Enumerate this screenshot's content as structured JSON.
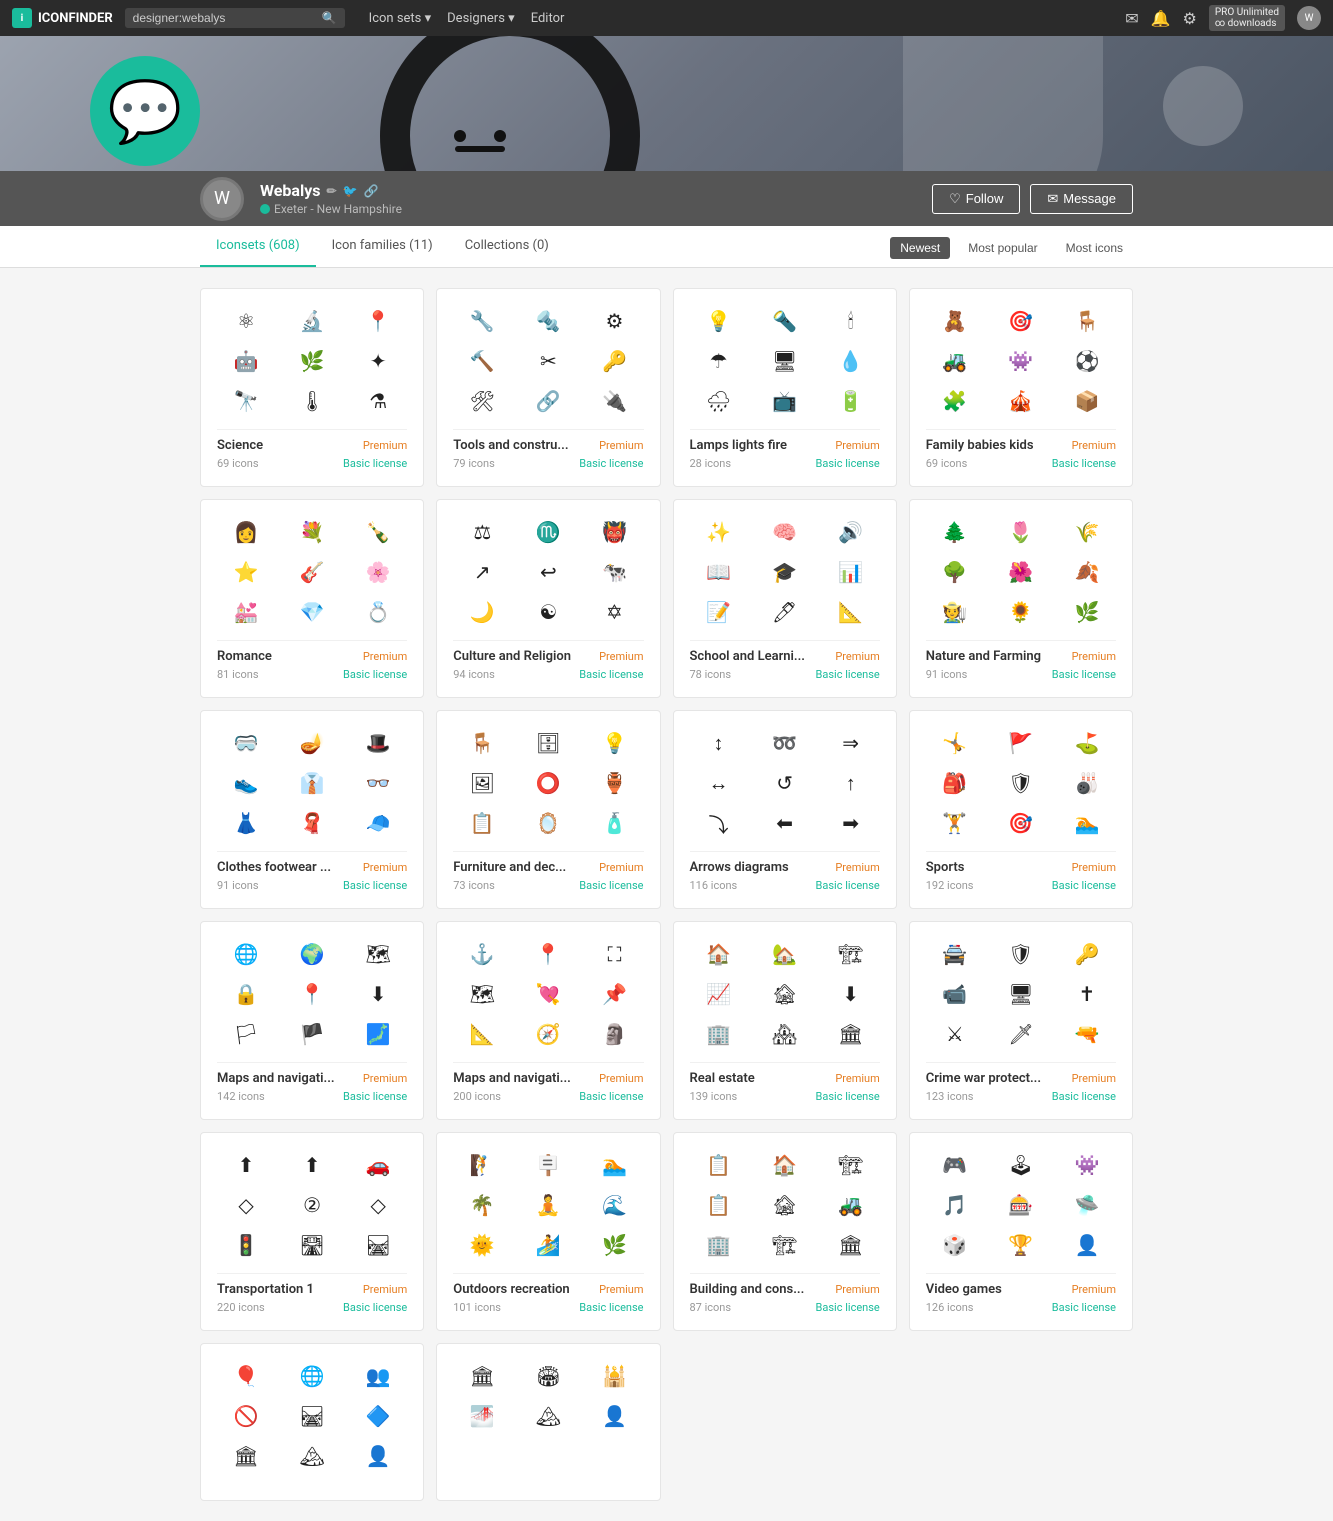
{
  "navbar": {
    "brand": "ICONFINDER",
    "search_placeholder": "designer:webalys",
    "search_value": "designer:webalys",
    "nav_links": [
      {
        "label": "Icon sets",
        "has_dropdown": true
      },
      {
        "label": "Designers",
        "has_dropdown": true
      },
      {
        "label": "Editor",
        "has_dropdown": false
      }
    ],
    "pro_label": "PRO Unlimited",
    "pro_sub": "∞ downloads"
  },
  "hero": {},
  "profile": {
    "name": "Webalys",
    "location": "Exeter - New Hampshire",
    "follow_btn": "Follow",
    "message_btn": "Message"
  },
  "tabs": {
    "items": [
      {
        "label": "Iconsets (608)",
        "active": true
      },
      {
        "label": "Icon families (11)",
        "active": false
      },
      {
        "label": "Collections (0)",
        "active": false
      }
    ],
    "filters": [
      {
        "label": "Newest",
        "active": true
      },
      {
        "label": "Most popular",
        "active": false
      },
      {
        "label": "Most icons",
        "active": false
      }
    ]
  },
  "cards": [
    {
      "title": "Science",
      "count": "69 icons",
      "premium": "Premium",
      "license": "Basic license",
      "icons": [
        "⚛",
        "🔬",
        "📍",
        "🤖",
        "🌿",
        "✦",
        "🔭",
        "🌡",
        "⚗"
      ]
    },
    {
      "title": "Tools and constru...",
      "count": "79 icons",
      "premium": "Premium",
      "license": "Basic license",
      "icons": [
        "🔧",
        "🔩",
        "⚙",
        "🔨",
        "✂",
        "🔑",
        "🛠",
        "🔗",
        "🔌"
      ]
    },
    {
      "title": "Lamps lights fire",
      "count": "28 icons",
      "premium": "Premium",
      "license": "Basic license",
      "icons": [
        "💡",
        "🔦",
        "🕯",
        "☂",
        "🖥",
        "💧",
        "🌧",
        "📺",
        "🔋"
      ]
    },
    {
      "title": "Family babies kids",
      "count": "69 icons",
      "premium": "Premium",
      "license": "Basic license",
      "icons": [
        "🧸",
        "🎯",
        "🪑",
        "🚜",
        "👾",
        "⚽",
        "🧩",
        "🎪",
        "📦"
      ]
    },
    {
      "title": "Romance",
      "count": "81 icons",
      "premium": "Premium",
      "license": "Basic license",
      "icons": [
        "👩",
        "💐",
        "🍾",
        "⭐",
        "🎸",
        "🌸",
        "💒",
        "💎",
        "💍"
      ]
    },
    {
      "title": "Culture and Religion",
      "count": "94 icons",
      "premium": "Premium",
      "license": "Basic license",
      "icons": [
        "⚖",
        "♏",
        "👹",
        "↗",
        "↩",
        "🐄",
        "🌙",
        "☯",
        "✡"
      ]
    },
    {
      "title": "School and Learni...",
      "count": "78 icons",
      "premium": "Premium",
      "license": "Basic license",
      "icons": [
        "✨",
        "🧠",
        "🔊",
        "📖",
        "🎓",
        "📊",
        "📝",
        "🖊",
        "📐"
      ]
    },
    {
      "title": "Nature and Farming",
      "count": "91 icons",
      "premium": "Premium",
      "license": "Basic license",
      "icons": [
        "🌲",
        "🌷",
        "🌾",
        "🌳",
        "🌺",
        "🍂",
        "🧑‍🌾",
        "🌻",
        "🌿"
      ]
    },
    {
      "title": "Clothes footwear ...",
      "count": "91 icons",
      "premium": "Premium",
      "license": "Basic license",
      "icons": [
        "🥽",
        "🪔",
        "🎩",
        "👟",
        "👔",
        "👓",
        "👗",
        "🧣",
        "🧢"
      ]
    },
    {
      "title": "Furniture and dec...",
      "count": "73 icons",
      "premium": "Premium",
      "license": "Basic license",
      "icons": [
        "🪑",
        "🗄",
        "💡",
        "🖼",
        "⭕",
        "🏺",
        "📋",
        "🪞",
        "🧴"
      ]
    },
    {
      "title": "Arrows diagrams",
      "count": "116 icons",
      "premium": "Premium",
      "license": "Basic license",
      "icons": [
        "↕",
        "➿",
        "⇒",
        "↔",
        "↺",
        "↑",
        "⤵",
        "⬅",
        "➡"
      ]
    },
    {
      "title": "Sports",
      "count": "192 icons",
      "premium": "Premium",
      "license": "Basic license",
      "icons": [
        "🤸",
        "🚩",
        "⛳",
        "🎒",
        "🛡",
        "🎳",
        "🏋",
        "🎯",
        "🏊"
      ]
    },
    {
      "title": "Maps and navigati...",
      "count": "142 icons",
      "premium": "Premium",
      "license": "Basic license",
      "icons": [
        "🌐",
        "🌍",
        "🗺",
        "🔒",
        "📍",
        "⬇",
        "🏳",
        "🏴",
        "🗾"
      ]
    },
    {
      "title": "Maps and navigati...",
      "count": "200 icons",
      "premium": "Premium",
      "license": "Basic license",
      "icons": [
        "⚓",
        "📍",
        "⛶",
        "🗺",
        "💘",
        "📌",
        "📐",
        "🧭",
        "🗿"
      ]
    },
    {
      "title": "Real estate",
      "count": "139 icons",
      "premium": "Premium",
      "license": "Basic license",
      "icons": [
        "🏠",
        "🏡",
        "🏗",
        "📈",
        "🏚",
        "⬇",
        "🏢",
        "🏘",
        "🏛"
      ]
    },
    {
      "title": "Crime war protect...",
      "count": "123 icons",
      "premium": "Premium",
      "license": "Basic license",
      "icons": [
        "🚔",
        "🛡",
        "🔑",
        "📹",
        "🖥",
        "✝",
        "⚔",
        "🗡",
        "🔫"
      ]
    },
    {
      "title": "Transportation 1",
      "count": "220 icons",
      "premium": "Premium",
      "license": "Basic license",
      "icons": [
        "⬆",
        "⬆",
        "🚗",
        "◇",
        "②",
        "◇",
        "🚦",
        "🛣",
        "🛤"
      ]
    },
    {
      "title": "Outdoors recreation",
      "count": "101 icons",
      "premium": "Premium",
      "license": "Basic license",
      "icons": [
        "🧗",
        "🪧",
        "🏊",
        "🌴",
        "🧘",
        "🌊",
        "🌞",
        "🏄",
        "🌿"
      ]
    },
    {
      "title": "Building and cons...",
      "count": "87 icons",
      "premium": "Premium",
      "license": "Basic license",
      "icons": [
        "📋",
        "🏠",
        "🏗",
        "📋",
        "🏚",
        "🚜",
        "🏢",
        "🏗",
        "🏛"
      ]
    },
    {
      "title": "Video games",
      "count": "126 icons",
      "premium": "Premium",
      "license": "Basic license",
      "icons": [
        "🎮",
        "🕹",
        "👾",
        "🎵",
        "🎰",
        "🛸",
        "🎲",
        "🏆",
        "👤"
      ]
    },
    {
      "title": "",
      "count": "",
      "premium": "",
      "license": "",
      "icons": [
        "🎈",
        "🌐",
        "👥",
        "🚫",
        "🛤",
        "🔷",
        "🏛",
        "🏔",
        "👤"
      ],
      "partial": true
    },
    {
      "title": "",
      "count": "",
      "premium": "",
      "license": "",
      "icons": [
        "🏛",
        "🏟",
        "🕌",
        "🌁",
        "🏔",
        "👤",
        "",
        "",
        ""
      ],
      "partial": true
    }
  ]
}
